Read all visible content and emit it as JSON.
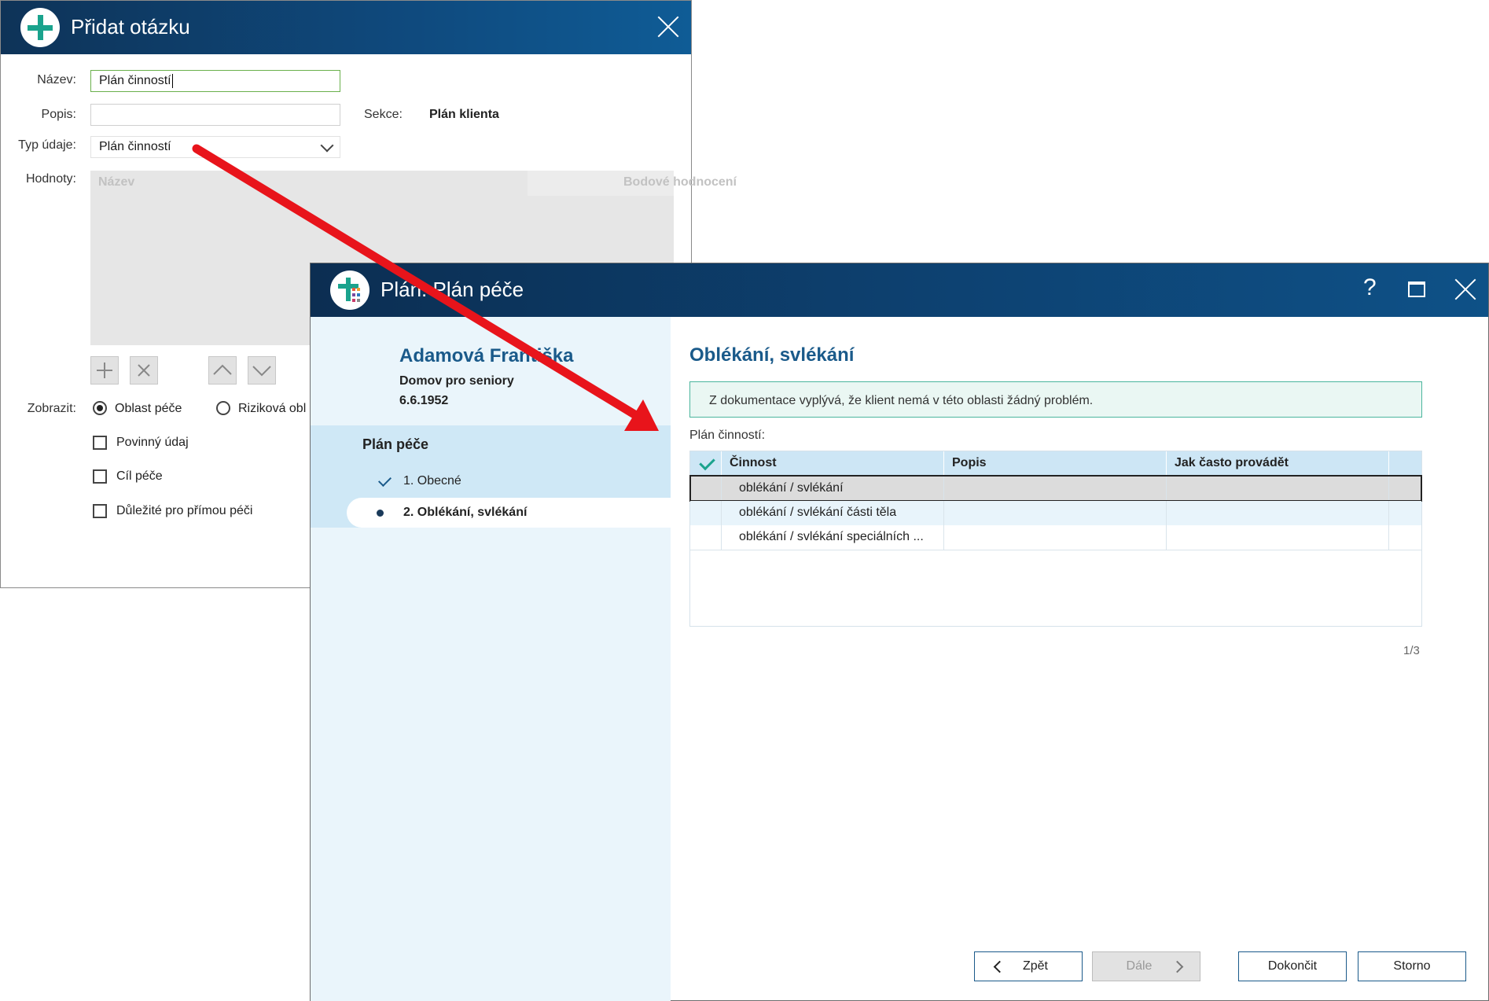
{
  "dialog1": {
    "title": "Přidat otázku",
    "labels": {
      "name": "Název:",
      "description": "Popis:",
      "data_type": "Typ údaje:",
      "values": "Hodnoty:",
      "section": "Sekce:",
      "show": "Zobrazit:"
    },
    "name_value": "Plán činností",
    "description_value": "",
    "section_value": "Plán klienta",
    "data_type_value": "Plán činností",
    "values_grid_headers": [
      "Název",
      "Bodové hodnocení"
    ],
    "show_options": [
      {
        "label": "Oblast péče",
        "selected": true
      },
      {
        "label": "Riziková obl",
        "selected": false
      }
    ],
    "checkboxes": [
      {
        "label": "Povinný údaj",
        "checked": false
      },
      {
        "label": "Cíl péče",
        "checked": false
      },
      {
        "label": "Důležité pro přímou péči",
        "checked": false
      }
    ]
  },
  "dialog2": {
    "title": "Plán: Plán péče",
    "patient": {
      "name": "Adamová Františka",
      "facility": "Domov pro seniory",
      "birth_date": "6.6.1952"
    },
    "plan_heading": "Plán péče",
    "steps": [
      {
        "label": "1. Obecné",
        "state": "done"
      },
      {
        "label": "2. Oblékání, svlékání",
        "state": "active"
      }
    ],
    "section_title": "Oblékání, svlékání",
    "info_message": "Z dokumentace vyplývá, že klient nemá v této oblasti žádný problém.",
    "activity_plan_label": "Plán činností:",
    "table": {
      "columns": [
        "Činnost",
        "Popis",
        "Jak často provádět"
      ],
      "rows": [
        [
          "oblékání / svlékání",
          "",
          ""
        ],
        [
          "oblékání / svlékání části těla",
          "",
          ""
        ],
        [
          "oblékání / svlékání speciálních ...",
          "",
          ""
        ]
      ]
    },
    "pager": "1/3",
    "buttons": {
      "back": "Zpět",
      "next": "Dále",
      "finish": "Dokončit",
      "cancel": "Storno"
    },
    "titlebar_help": "?"
  },
  "colors": {
    "titlebar": "#0f4a7e",
    "accent_teal": "#1aa38d",
    "arrow_red": "#e8141b",
    "patient_blue": "#1a5a8a"
  }
}
